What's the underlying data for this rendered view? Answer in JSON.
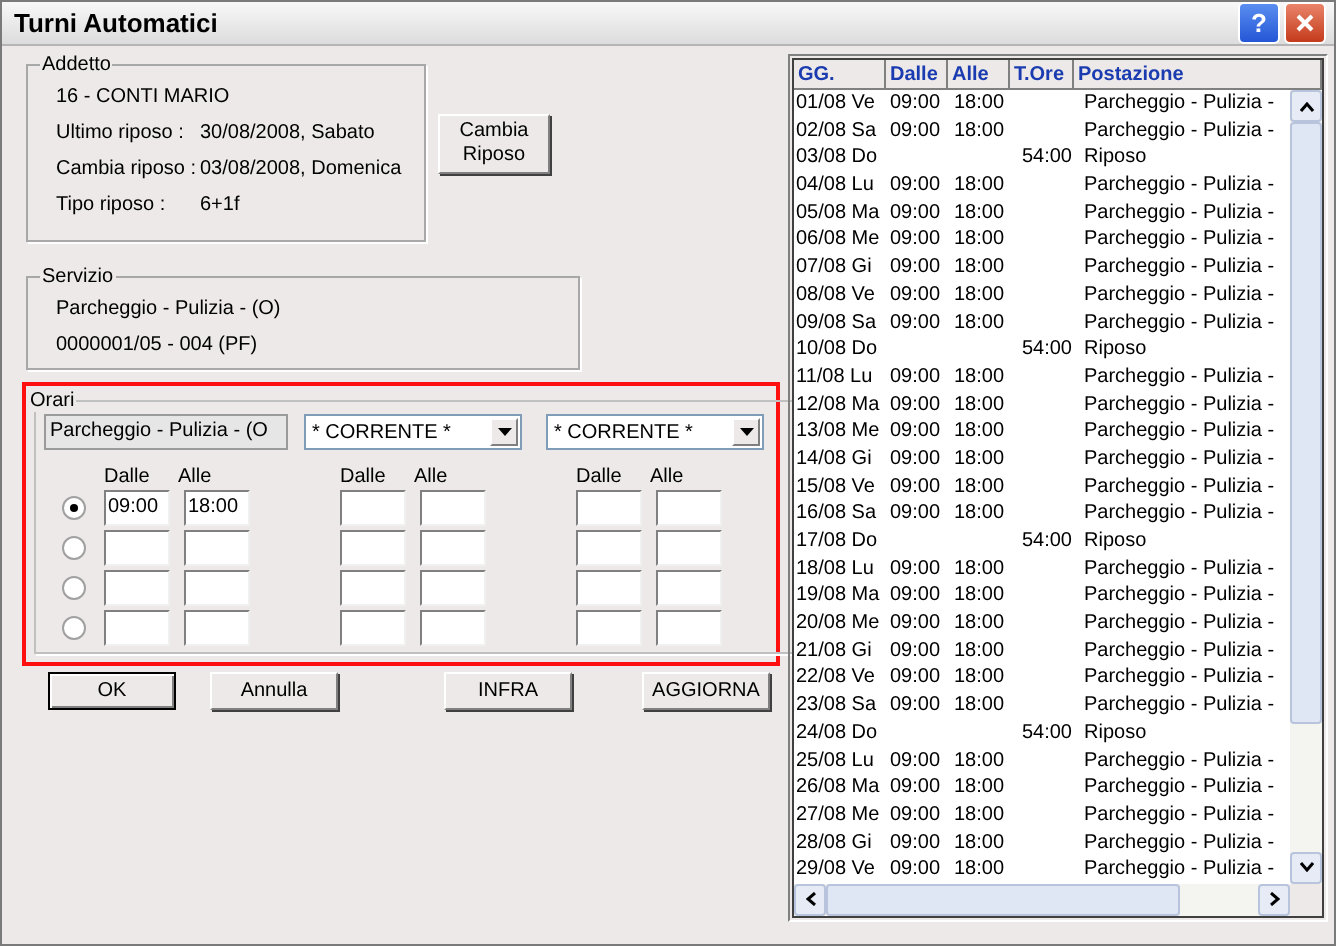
{
  "window": {
    "title": "Turni Automatici",
    "help": "?"
  },
  "addetto": {
    "legend": "Addetto",
    "name": "16 - CONTI MARIO",
    "fields": [
      {
        "label": "Ultimo riposo :",
        "value": "30/08/2008, Sabato"
      },
      {
        "label": "Cambia riposo :",
        "value": "03/08/2008, Domenica"
      },
      {
        "label": "Tipo riposo :",
        "value": "6+1f"
      }
    ]
  },
  "cambia_button": [
    "Cambia",
    "Riposo"
  ],
  "servizio": {
    "legend": "Servizio",
    "lines": [
      "Parcheggio - Pulizia - (O)",
      "0000001/05 - 004 (PF)"
    ]
  },
  "orari": {
    "legend": "Orari",
    "highlighted": true,
    "service_field": "Parcheggio - Pulizia - (O",
    "dropdowns": [
      "* CORRENTE *",
      "* CORRENTE *"
    ],
    "headers": [
      "Dalle",
      "Alle",
      "Dalle",
      "Alle",
      "Dalle",
      "Alle"
    ],
    "rows": [
      {
        "selected": true,
        "values": [
          "09:00",
          "18:00"
        ]
      },
      {
        "selected": false,
        "values": []
      },
      {
        "selected": false,
        "values": []
      },
      {
        "selected": false,
        "values": []
      }
    ]
  },
  "buttons": [
    {
      "label": "OK",
      "default": true
    },
    {
      "label": "Annulla",
      "default": false
    },
    {
      "label": "INFRA",
      "default": false
    },
    {
      "label": "AGGIORNA",
      "default": false
    }
  ],
  "table": {
    "columns": [
      "GG.",
      "Dalle",
      "Alle",
      "T.Ore",
      "Postazione"
    ],
    "rows": [
      [
        "01/08 Ve",
        "09:00",
        "18:00",
        "",
        "Parcheggio - Pulizia -"
      ],
      [
        "02/08 Sa",
        "09:00",
        "18:00",
        "",
        "Parcheggio - Pulizia -"
      ],
      [
        "03/08 Do",
        "",
        "",
        "54:00",
        "Riposo"
      ],
      [
        "04/08 Lu",
        "09:00",
        "18:00",
        "",
        "Parcheggio - Pulizia -"
      ],
      [
        "05/08 Ma",
        "09:00",
        "18:00",
        "",
        "Parcheggio - Pulizia -"
      ],
      [
        "06/08 Me",
        "09:00",
        "18:00",
        "",
        "Parcheggio - Pulizia -"
      ],
      [
        "07/08 Gi",
        "09:00",
        "18:00",
        "",
        "Parcheggio - Pulizia -"
      ],
      [
        "08/08 Ve",
        "09:00",
        "18:00",
        "",
        "Parcheggio - Pulizia -"
      ],
      [
        "09/08 Sa",
        "09:00",
        "18:00",
        "",
        "Parcheggio - Pulizia -"
      ],
      [
        "10/08 Do",
        "",
        "",
        "54:00",
        "Riposo"
      ],
      [
        "11/08 Lu",
        "09:00",
        "18:00",
        "",
        "Parcheggio - Pulizia -"
      ],
      [
        "12/08 Ma",
        "09:00",
        "18:00",
        "",
        "Parcheggio - Pulizia -"
      ],
      [
        "13/08 Me",
        "09:00",
        "18:00",
        "",
        "Parcheggio - Pulizia -"
      ],
      [
        "14/08 Gi",
        "09:00",
        "18:00",
        "",
        "Parcheggio - Pulizia -"
      ],
      [
        "15/08 Ve",
        "09:00",
        "18:00",
        "",
        "Parcheggio - Pulizia -"
      ],
      [
        "16/08 Sa",
        "09:00",
        "18:00",
        "",
        "Parcheggio - Pulizia -"
      ],
      [
        "17/08 Do",
        "",
        "",
        "54:00",
        "Riposo"
      ],
      [
        "18/08 Lu",
        "09:00",
        "18:00",
        "",
        "Parcheggio - Pulizia -"
      ],
      [
        "19/08 Ma",
        "09:00",
        "18:00",
        "",
        "Parcheggio - Pulizia -"
      ],
      [
        "20/08 Me",
        "09:00",
        "18:00",
        "",
        "Parcheggio - Pulizia -"
      ],
      [
        "21/08 Gi",
        "09:00",
        "18:00",
        "",
        "Parcheggio - Pulizia -"
      ],
      [
        "22/08 Ve",
        "09:00",
        "18:00",
        "",
        "Parcheggio - Pulizia -"
      ],
      [
        "23/08 Sa",
        "09:00",
        "18:00",
        "",
        "Parcheggio - Pulizia -"
      ],
      [
        "24/08 Do",
        "",
        "",
        "54:00",
        "Riposo"
      ],
      [
        "25/08 Lu",
        "09:00",
        "18:00",
        "",
        "Parcheggio - Pulizia -"
      ],
      [
        "26/08 Ma",
        "09:00",
        "18:00",
        "",
        "Parcheggio - Pulizia -"
      ],
      [
        "27/08 Me",
        "09:00",
        "18:00",
        "",
        "Parcheggio - Pulizia -"
      ],
      [
        "28/08 Gi",
        "09:00",
        "18:00",
        "",
        "Parcheggio - Pulizia -"
      ],
      [
        "29/08 Ve",
        "09:00",
        "18:00",
        "",
        "Parcheggio - Pulizia -"
      ]
    ]
  }
}
